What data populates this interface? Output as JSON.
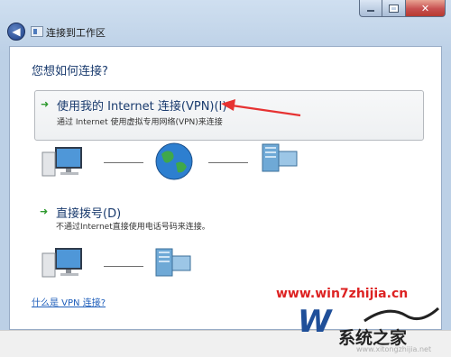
{
  "window": {
    "nav_title": "连接到工作区",
    "minimize_label": "",
    "maximize_label": "",
    "close_label": "✕"
  },
  "nav": {
    "back_icon": "back-arrow-icon"
  },
  "content": {
    "heading": "您想如何连接?",
    "options": [
      {
        "title": "使用我的 Internet 连接(VPN)(I)",
        "description": "通过 Internet 使用虚拟专用网络(VPN)来连接"
      },
      {
        "title": "直接拨号(D)",
        "description": "不通过Internet直接使用电话号码来连接。"
      }
    ],
    "help_link": "什么是 VPN 连接?"
  },
  "watermark": {
    "url": "www.win7zhijia.cn",
    "site_name": "系统之家",
    "site_small": "www.xitongzhijia.net"
  },
  "colors": {
    "accent_arrow": "#e63232",
    "heading_blue": "#1a3b6e",
    "link_blue": "#1d5dba",
    "go_green": "#2f9a2f"
  }
}
